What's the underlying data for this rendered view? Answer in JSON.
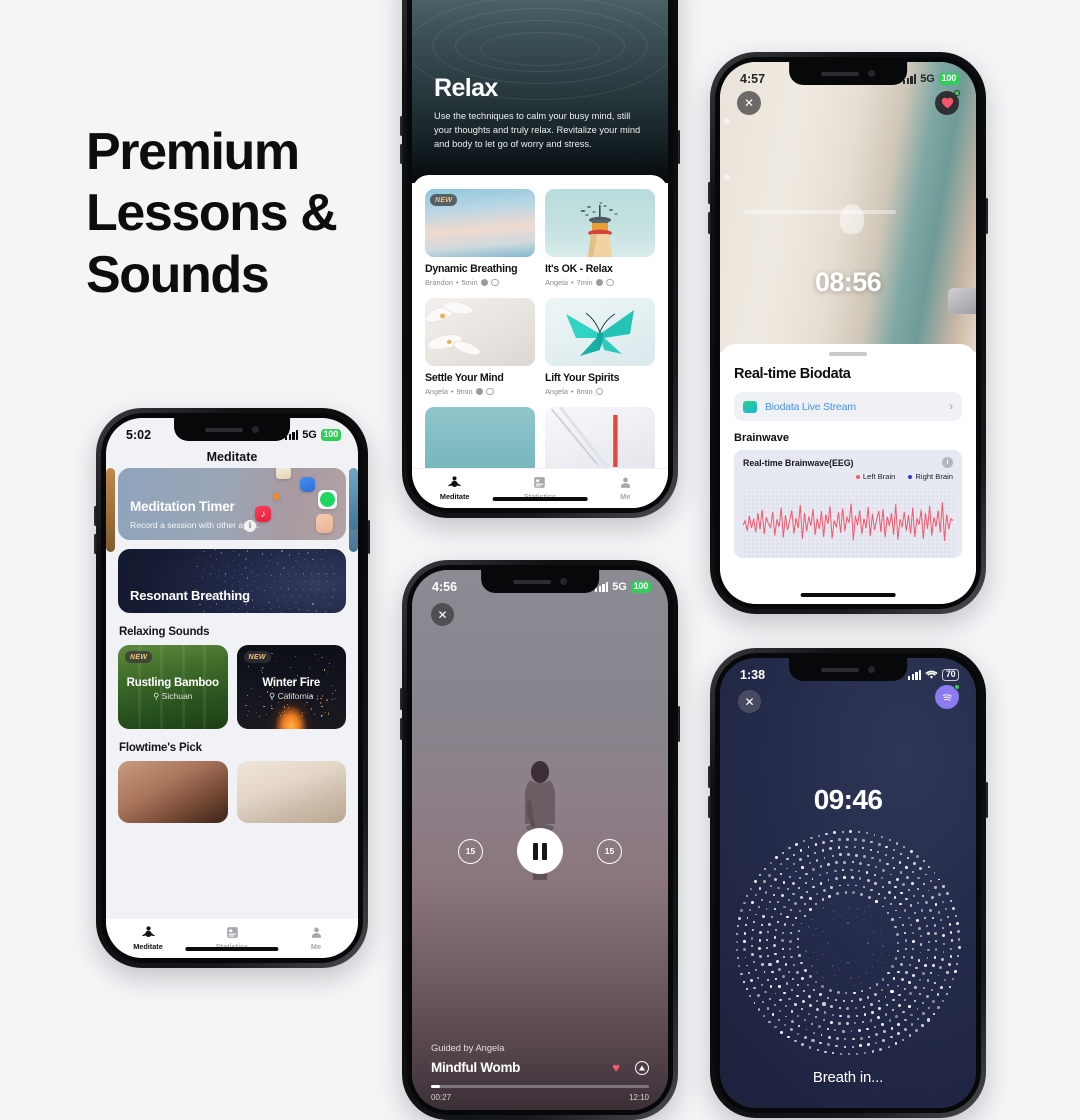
{
  "headline": {
    "line1": "Premium",
    "line2": "Lessons &",
    "line3": "Sounds"
  },
  "background_color": "#f4f5f7",
  "phone_meditate": {
    "status": {
      "time": "5:02",
      "network": "5G",
      "battery": "100"
    },
    "nav_title": "Meditate",
    "timer_card": {
      "title": "Meditation Timer",
      "subtitle": "Record a session with other apps.",
      "info_icon": "info-icon",
      "app_icons": [
        "coffee-app-icon",
        "calm-app-icon",
        "orange-dot-icon",
        "spotify-icon",
        "apple-music-icon",
        "books-app-icon"
      ]
    },
    "breathing_card": {
      "title": "Resonant Breathing"
    },
    "section_sounds": "Relaxing Sounds",
    "sounds": [
      {
        "badge": "NEW",
        "title": "Rustling Bamboo",
        "location": "Sichuan"
      },
      {
        "badge": "NEW",
        "title": "Winter Fire",
        "location": "California"
      }
    ],
    "section_pick": "Flowtime's Pick",
    "tabs": [
      {
        "label": "Meditate",
        "icon": "meditate-icon",
        "active": true
      },
      {
        "label": "Statistics",
        "icon": "statistics-icon",
        "active": false
      },
      {
        "label": "Me",
        "icon": "profile-icon",
        "active": false
      }
    ]
  },
  "phone_relax": {
    "back_icon": "chevron-left-icon",
    "title": "Relax",
    "description": "Use the techniques to calm your busy mind, still your thoughts and truly relax. Revitalize your mind and body to let go of worry and stress.",
    "lessons": [
      {
        "badge": "NEW",
        "title": "Dynamic Breathing",
        "author": "Brandon",
        "duration": "5min",
        "thumb": "clouds-thumb"
      },
      {
        "badge": "",
        "title": "It's OK - Relax",
        "author": "Angela",
        "duration": "7min",
        "thumb": "lighthouse-thumb"
      },
      {
        "badge": "",
        "title": "Settle Your Mind",
        "author": "Angela",
        "duration": "9min",
        "thumb": "flower-thumb"
      },
      {
        "badge": "",
        "title": "Lift Your Spirits",
        "author": "Angela",
        "duration": "8min",
        "thumb": "origami-butterfly-thumb"
      }
    ],
    "meta_separator": "•",
    "tabs": [
      {
        "label": "Meditate",
        "icon": "meditate-icon",
        "active": true
      },
      {
        "label": "Statistics",
        "icon": "statistics-icon",
        "active": false
      },
      {
        "label": "Me",
        "icon": "profile-icon",
        "active": false
      }
    ]
  },
  "phone_biodata": {
    "status": {
      "time": "4:57",
      "network": "5G",
      "battery": "100"
    },
    "close_icon": "close-icon",
    "heart_icon": "heart-rate-icon",
    "session_time": "08:56",
    "sheet_title": "Real-time Biodata",
    "live_stream": {
      "label": "Biodata Live Stream",
      "icon": "chart-app-icon",
      "chevron": "chevron-right-icon"
    },
    "section_brainwave": "Brainwave",
    "eeg": {
      "title": "Real-time Brainwave(EEG)",
      "info_icon": "info-icon",
      "legend": [
        {
          "label": "Left Brain",
          "color": "#f8566b"
        },
        {
          "label": "Right Brain",
          "color": "#2a3bd0"
        }
      ]
    },
    "chart_data": {
      "type": "line",
      "title": "Real-time Brainwave(EEG)",
      "xlabel": "",
      "ylabel": "",
      "grid": true,
      "legend_position": "top-right",
      "series": [
        {
          "name": "Left Brain",
          "color": "#f8566b",
          "values": [
            48,
            55,
            40,
            62,
            44,
            58,
            38,
            66,
            42,
            71,
            35,
            60,
            50,
            45,
            68,
            33,
            57,
            46,
            74,
            30,
            63,
            41,
            55,
            70,
            36,
            59,
            44,
            78,
            28,
            66,
            39,
            61,
            47,
            72,
            34,
            58,
            43,
            69,
            31,
            64,
            50,
            76,
            29,
            55,
            45,
            67,
            37,
            73,
            40,
            60,
            52,
            80,
            26,
            62,
            48,
            70,
            35,
            58,
            44,
            75,
            32,
            65,
            41,
            56,
            69,
            38,
            72,
            30,
            61,
            47,
            66,
            34,
            79,
            27,
            57,
            45,
            68,
            40,
            63,
            36,
            74,
            31,
            59,
            49,
            71,
            28,
            66,
            43,
            77,
            33,
            60,
            46,
            70,
            38,
            82,
            25,
            64,
            42,
            58,
            55
          ]
        },
        {
          "name": "Right Brain",
          "color": "#2a3bd0",
          "values": []
        }
      ],
      "ylim": [
        0,
        100
      ]
    }
  },
  "phone_player": {
    "status": {
      "time": "4:56",
      "network": "5G",
      "battery": "100"
    },
    "close_icon": "close-icon",
    "controls": {
      "rewind_label": "15",
      "forward_label": "15",
      "play_state": "pause"
    },
    "guided_by": "Guided by Angela",
    "track_title": "Mindful Womb",
    "favorite_icon": "heart-filled-icon",
    "airplay_icon": "airplay-icon",
    "elapsed": "00:27",
    "total": "12:10",
    "progress_percent": 4
  },
  "phone_breathing": {
    "status": {
      "time": "1:38",
      "wifi": "wifi-icon",
      "battery": "70"
    },
    "close_icon": "close-icon",
    "spotify_icon": "spotify-connect-icon",
    "session_time": "09:46",
    "prompt": "Breath in..."
  }
}
